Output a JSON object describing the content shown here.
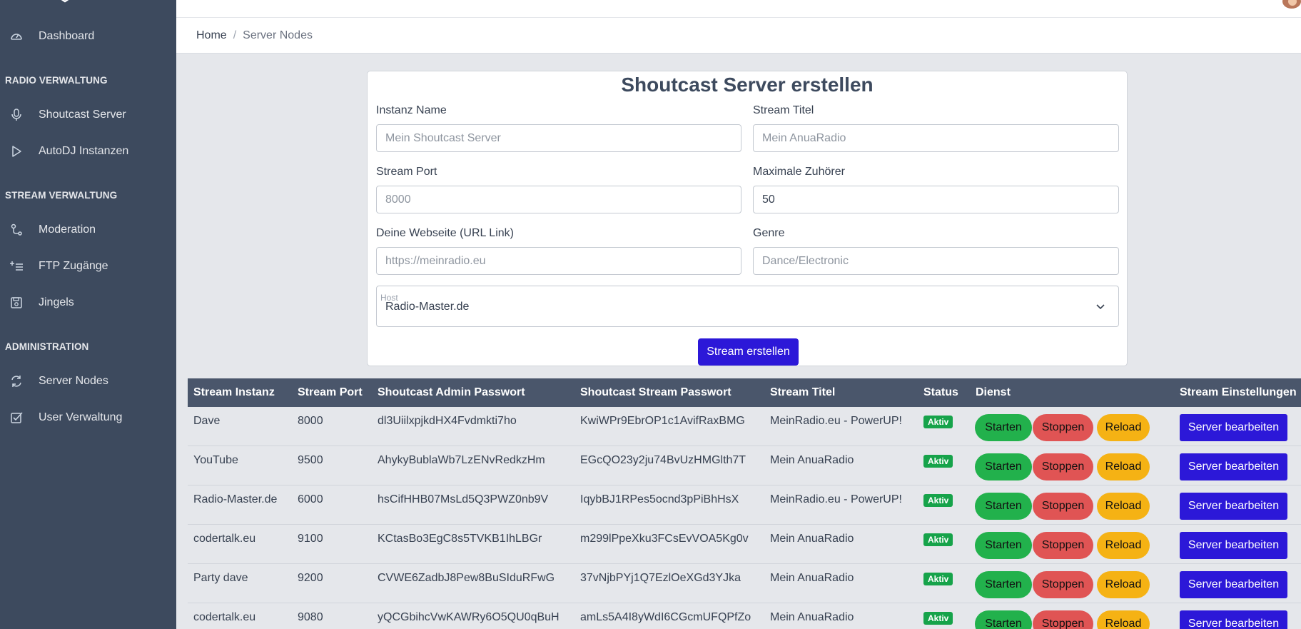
{
  "sidebar": {
    "items": [
      {
        "label": "Dashboard",
        "icon": "gauge-icon"
      },
      {
        "label": "Shoutcast Server",
        "icon": "microphone-icon"
      },
      {
        "label": "AutoDJ Instanzen",
        "icon": "play-icon"
      },
      {
        "label": "Moderation",
        "icon": "moderation-icon"
      },
      {
        "label": "FTP Zugänge",
        "icon": "list-add-icon"
      },
      {
        "label": "Jingels",
        "icon": "floppy-disk-icon"
      },
      {
        "label": "Server Nodes",
        "icon": "sync-icon"
      },
      {
        "label": "User Verwaltung",
        "icon": "checkbox-icon"
      }
    ],
    "sections": [
      "RADIO VERWALTUNG",
      "STREAM VERWALTUNG",
      "ADMINISTRATION"
    ]
  },
  "breadcrumb": {
    "home": "Home",
    "separator": "/",
    "current": "Server Nodes"
  },
  "form": {
    "title": "Shoutcast Server erstellen",
    "instance_name": {
      "label": "Instanz Name",
      "placeholder": "Mein Shoutcast Server",
      "value": ""
    },
    "stream_title": {
      "label": "Stream Titel",
      "placeholder": "Mein AnuaRadio",
      "value": ""
    },
    "stream_port": {
      "label": "Stream Port",
      "placeholder": "8000",
      "value": ""
    },
    "max_listeners": {
      "label": "Maximale Zuhörer",
      "placeholder": "",
      "value": "50"
    },
    "website": {
      "label": "Deine Webseite (URL Link)",
      "placeholder": "https://meinradio.eu",
      "value": ""
    },
    "genre": {
      "label": "Genre",
      "placeholder": "Dance/Electronic",
      "value": ""
    },
    "host": {
      "label": "Host",
      "value": "Radio-Master.de"
    },
    "submit": "Stream erstellen"
  },
  "table": {
    "headers": [
      "Stream Instanz",
      "Stream Port",
      "Shoutcast Admin Passwort",
      "Shoutcast Stream Passwort",
      "Stream Titel",
      "Status",
      "Dienst",
      "Stream Einstellungen"
    ],
    "buttons": {
      "start": "Starten",
      "stop": "Stoppen",
      "reload": "Reload",
      "edit": "Server bearbeiten"
    },
    "rows": [
      {
        "name": "Dave",
        "port": "8000",
        "admin_pw": "dl3UiilxpjkdHX4Fvdmkti7ho",
        "stream_pw": "KwiWPr9EbrOP1c1AvifRaxBMG",
        "title": "MeinRadio.eu - PowerUP!",
        "status": "Aktiv"
      },
      {
        "name": "YouTube",
        "port": "9500",
        "admin_pw": "AhykyBublaWb7LzENvRedkzHm",
        "stream_pw": "EGcQO23y2ju74BvUzHMGlth7T",
        "title": "Mein AnuaRadio",
        "status": "Aktiv"
      },
      {
        "name": "Radio-Master.de",
        "port": "6000",
        "admin_pw": "hsCifHHB07MsLd5Q3PWZ0nb9V",
        "stream_pw": "IqybBJ1RPes5ocnd3pPiBhHsX",
        "title": "MeinRadio.eu - PowerUP!",
        "status": "Aktiv"
      },
      {
        "name": "codertalk.eu",
        "port": "9100",
        "admin_pw": "KCtasBo3EgC8s5TVKB1IhLBGr",
        "stream_pw": "m299lPpeXku3FCsEvVOA5Kg0v",
        "title": "Mein AnuaRadio",
        "status": "Aktiv"
      },
      {
        "name": "Party dave",
        "port": "9200",
        "admin_pw": "CVWE6ZadbJ8Pew8BuSIduRFwG",
        "stream_pw": "37vNjbPYj1Q7EzlOeXGd3YJka",
        "title": "Mein AnuaRadio",
        "status": "Aktiv"
      },
      {
        "name": "codertalk.eu",
        "port": "9080",
        "admin_pw": "yQCGbihcVwKAWRy6O5QU0qBuH",
        "stream_pw": "amLs5A4I8yWdI6CGcmUFQPfZo",
        "title": "Mein AnuaRadio",
        "status": "Aktiv"
      }
    ]
  },
  "colors": {
    "sidebar": "#3d4a5e",
    "primary": "#2c18d8",
    "start": "#22b14c",
    "stop": "#e05454",
    "reload": "#f5b214",
    "badge": "#16a34a"
  }
}
